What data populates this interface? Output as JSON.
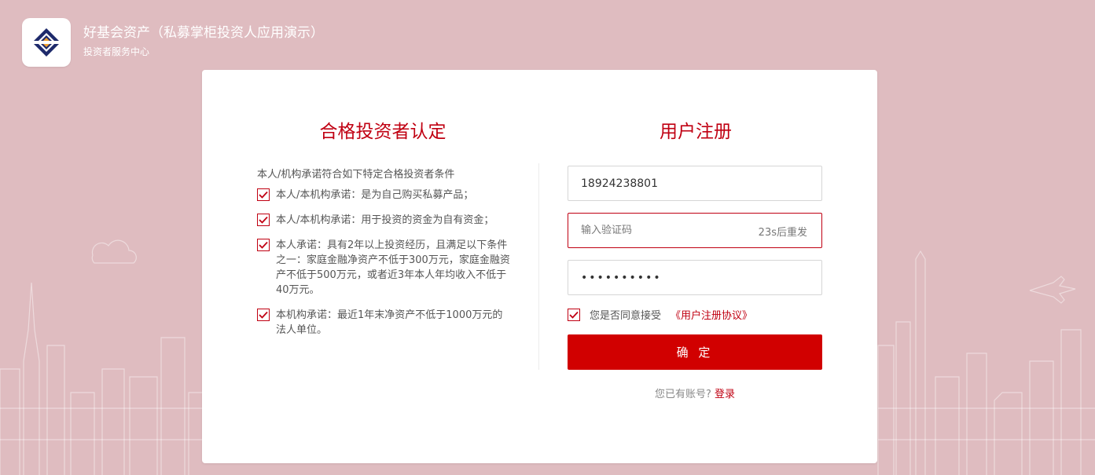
{
  "brand": {
    "title": "好基会资产（私募掌柜投资人应用演示）",
    "subtitle": "投资者服务中心",
    "logo_icon": "diamond-logo-icon"
  },
  "qualification": {
    "heading": "合格投资者认定",
    "intro": "本人/机构承诺符合如下特定合格投资者条件",
    "conditions": [
      {
        "text": "本人/本机构承诺：是为自己购买私募产品；",
        "checked": true
      },
      {
        "text": "本人/本机构承诺：用于投资的资金为自有资金；",
        "checked": true
      },
      {
        "text": "本人承诺：具有2年以上投资经历，且满足以下条件之一：家庭金融净资产不低于300万元，家庭金融资产不低于500万元，或者近3年本人年均收入不低于40万元。",
        "checked": true
      },
      {
        "text": "本机构承诺：最近1年末净资产不低于1000万元的法人单位。",
        "checked": true
      }
    ]
  },
  "register": {
    "heading": "用户注册",
    "phone_value": "18924238801",
    "code_placeholder": "输入验证码",
    "resend_label": "23s后重发",
    "password_value": "••••••••••",
    "agree_checked": true,
    "agree_text": "您是否同意接受",
    "agreement_link": "《用户注册协议》",
    "confirm_label": "确 定",
    "has_account_text": "您已有账号?",
    "login_link": "登录"
  },
  "colors": {
    "background": "#dfbcc0",
    "accent": "#c00012",
    "button": "#d10000"
  }
}
